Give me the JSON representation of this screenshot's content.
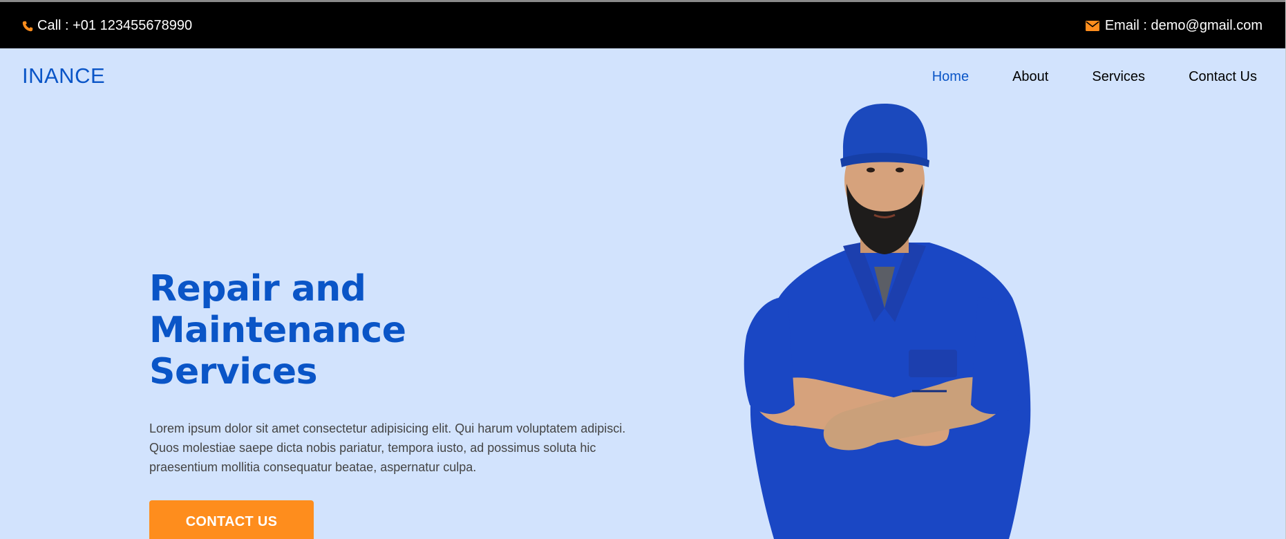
{
  "topbar": {
    "call_text": "Call : +01 123455678990",
    "email_text": "Email : demo@gmail.com",
    "icon_color": "#fe8d1d"
  },
  "brand": {
    "name": "INANCE"
  },
  "nav": {
    "items": [
      {
        "label": "Home",
        "active": true
      },
      {
        "label": "About"
      },
      {
        "label": "Services"
      },
      {
        "label": "Contact Us"
      }
    ]
  },
  "hero": {
    "title_lines": [
      "Repair and",
      "Maintenance",
      "Services"
    ],
    "description": "Lorem ipsum dolor sit amet consectetur adipisicing elit. Qui harum voluptatem adipisci. Quos molestiae saepe dicta nobis pariatur, tempora iusto, ad possimus soluta hic praesentium mollitia consequatur beatae, aspernatur culpa.",
    "cta_label": "CONTACT US"
  },
  "colors": {
    "brand_blue": "#0a55c7",
    "accent_orange": "#fe8d1d",
    "background": "#d2e3fd",
    "topbar": "#000000"
  }
}
